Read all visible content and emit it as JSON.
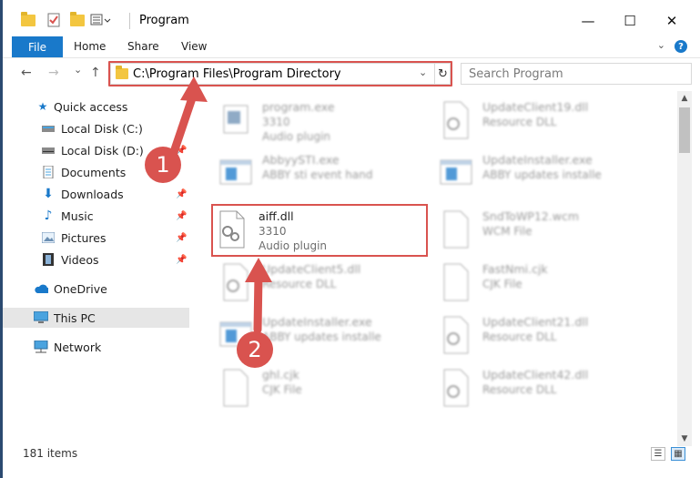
{
  "window": {
    "title": "Program",
    "minimize_glyph": "—",
    "maximize_glyph": "☐",
    "close_glyph": "✕"
  },
  "ribbon": {
    "file_tab": "File",
    "tabs": [
      "Home",
      "Share",
      "View"
    ],
    "help_glyph": "?"
  },
  "nav": {
    "back_glyph": "←",
    "forward_glyph": "→",
    "recent_glyph": "⌄",
    "up_glyph": "↑",
    "address": "C:\\Program Files\\Program Directory",
    "search_placeholder": "Search Program"
  },
  "sidebar": {
    "items": [
      {
        "label": "Quick access",
        "icon": "star-icon"
      },
      {
        "label": "Local Disk (C:)",
        "icon": "drive-icon"
      },
      {
        "label": "Local Disk (D:)",
        "icon": "drive-icon"
      },
      {
        "label": "Documents",
        "icon": "documents-icon"
      },
      {
        "label": "Downloads",
        "icon": "downloads-icon"
      },
      {
        "label": "Music",
        "icon": "music-icon"
      },
      {
        "label": "Pictures",
        "icon": "pictures-icon"
      },
      {
        "label": "Videos",
        "icon": "videos-icon"
      },
      {
        "label": "OneDrive",
        "icon": "cloud-icon"
      },
      {
        "label": "This PC",
        "icon": "computer-icon"
      },
      {
        "label": "Network",
        "icon": "network-icon"
      }
    ]
  },
  "files": [
    {
      "name": "program.exe",
      "l2": "3310",
      "l3": "Audio plugin"
    },
    {
      "name": "UpdateClient19.dll",
      "l2": "Resource DLL",
      "l3": ""
    },
    {
      "name": "AbbyySTI.exe",
      "l2": "ABBY sti event hand",
      "l3": ""
    },
    {
      "name": "UpdateInstaller.exe",
      "l2": "ABBY updates installe",
      "l3": ""
    },
    {
      "name": "aiff.dll",
      "l2": "3310",
      "l3": "Audio plugin"
    },
    {
      "name": "SndToWP12.wcm",
      "l2": "WCM File",
      "l3": ""
    },
    {
      "name": "UpdateClient5.dll",
      "l2": "Resource DLL",
      "l3": ""
    },
    {
      "name": "FastNmi.cjk",
      "l2": "CJK File",
      "l3": ""
    },
    {
      "name": "UpdateInstaller.exe",
      "l2": "ABBY updates installe",
      "l3": ""
    },
    {
      "name": "UpdateClient21.dll",
      "l2": "Resource DLL",
      "l3": ""
    },
    {
      "name": "ghl.cjk",
      "l2": "CJK File",
      "l3": ""
    },
    {
      "name": "UpdateClient42.dll",
      "l2": "Resource DLL",
      "l3": ""
    }
  ],
  "status": {
    "item_count": "181 items"
  },
  "annotations": {
    "step1": "1",
    "step2": "2"
  },
  "colors": {
    "accent": "#1979ca",
    "annotation": "#d9534f",
    "frame": "#2b4a70"
  }
}
